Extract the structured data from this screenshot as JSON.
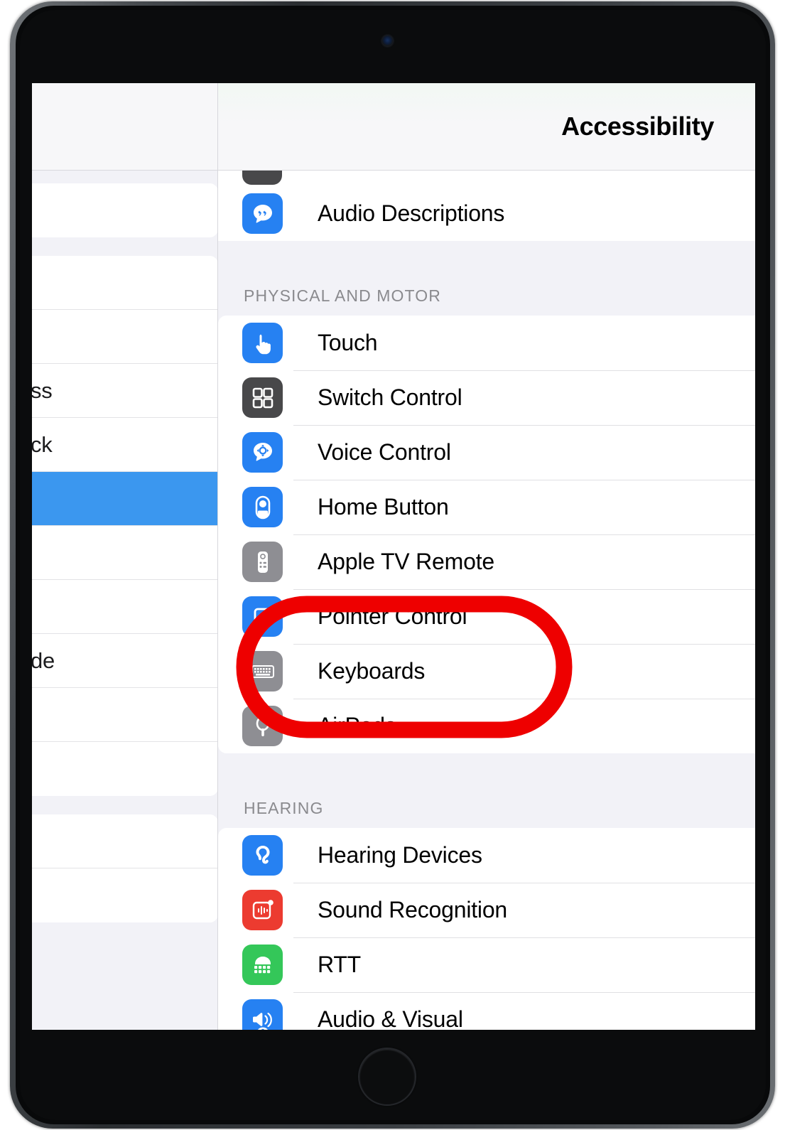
{
  "device": {
    "name": "iPad",
    "camera_icon": "front-camera",
    "home_button_icon": "home-button"
  },
  "sidebar": {
    "groups": [
      {
        "rows": [
          {
            "label": ""
          }
        ]
      },
      {
        "rows": [
          {
            "label": ""
          },
          {
            "label": ""
          },
          {
            "label": "ss"
          },
          {
            "label": "ck"
          },
          {
            "label": "",
            "selected": true
          },
          {
            "label": ""
          },
          {
            "label": ""
          },
          {
            "label": "de"
          },
          {
            "label": ""
          },
          {
            "label": ""
          }
        ]
      },
      {
        "rows": [
          {
            "label": ""
          },
          {
            "label": ""
          }
        ]
      }
    ]
  },
  "detail": {
    "nav": {
      "title": "Accessibility"
    },
    "sections": [
      {
        "header": "",
        "rows": [
          {
            "label": "Audio Descriptions",
            "icon": "audio-descriptions-icon",
            "icon_color": "#2681f2"
          }
        ]
      },
      {
        "header": "PHYSICAL AND MOTOR",
        "rows": [
          {
            "label": "Touch",
            "icon": "touch-icon",
            "icon_color": "#2681f2"
          },
          {
            "label": "Switch Control",
            "icon": "switch-control-icon",
            "icon_color": "#48484a"
          },
          {
            "label": "Voice Control",
            "icon": "voice-control-icon",
            "icon_color": "#2681f2"
          },
          {
            "label": "Home Button",
            "icon": "home-button-icon",
            "icon_color": "#2681f2"
          },
          {
            "label": "Apple TV Remote",
            "icon": "apple-tv-remote-icon",
            "icon_color": "#8e8e93"
          },
          {
            "label": "Pointer Control",
            "icon": "pointer-control-icon",
            "icon_color": "#2681f2"
          },
          {
            "label": "Keyboards",
            "icon": "keyboards-icon",
            "icon_color": "#8e8e93"
          },
          {
            "label": "AirPods",
            "icon": "airpods-icon",
            "icon_color": "#8e8e93"
          }
        ]
      },
      {
        "header": "HEARING",
        "rows": [
          {
            "label": "Hearing Devices",
            "icon": "hearing-devices-icon",
            "icon_color": "#2681f2"
          },
          {
            "label": "Sound Recognition",
            "icon": "sound-recognition-icon",
            "icon_color": "#ec3b30"
          },
          {
            "label": "RTT",
            "icon": "rtt-icon",
            "icon_color": "#34c759"
          },
          {
            "label": "Audio & Visual",
            "icon": "audio-visual-icon",
            "icon_color": "#2681f2"
          }
        ]
      }
    ]
  },
  "annotation": {
    "type": "red-rounded-rectangle-highlight",
    "color": "#ee0000",
    "stroke_width": 22,
    "targets": [
      "Pointer Control",
      "Keyboards",
      "AirPods"
    ]
  }
}
